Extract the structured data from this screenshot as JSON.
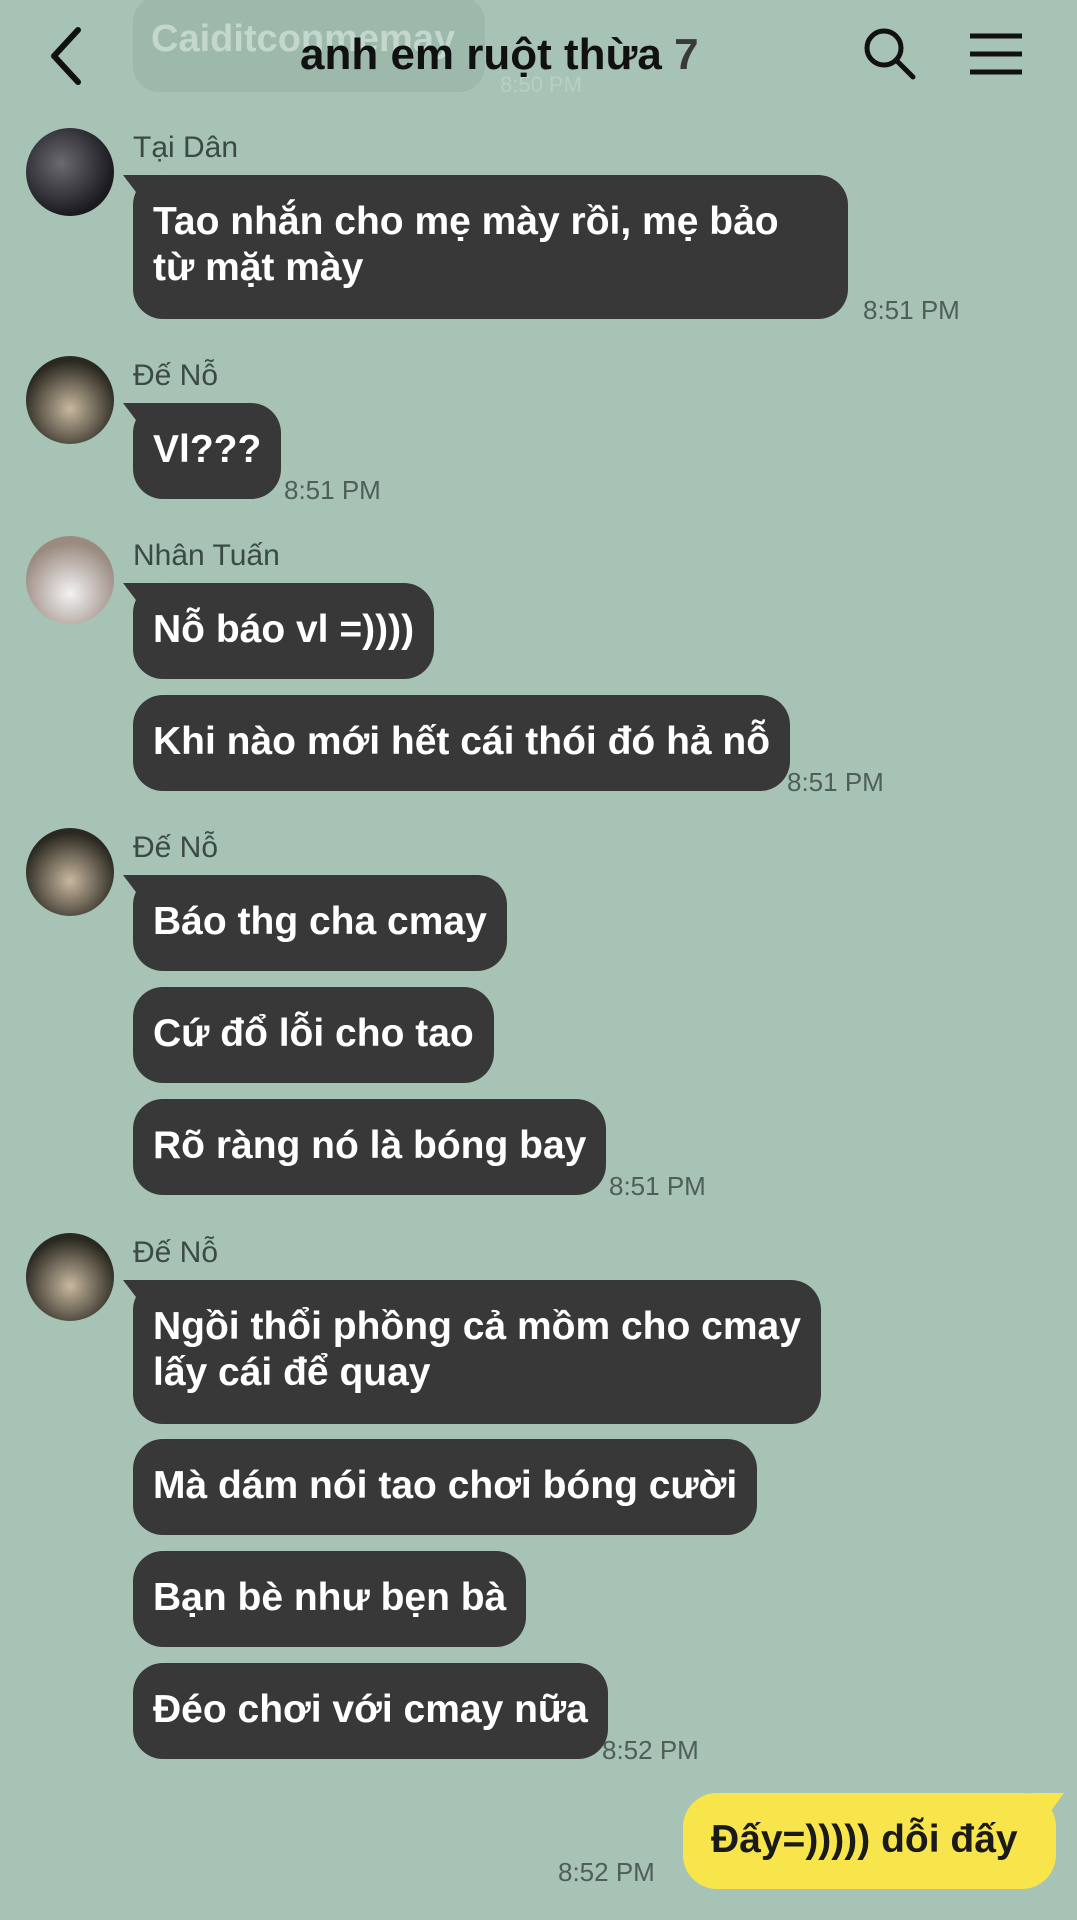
{
  "header": {
    "ghost_message": "Caiditconmemay",
    "ghost_time": "8:50 PM",
    "title": "anh em ruột thừa",
    "member_count": "7"
  },
  "messages": [
    {
      "sender": "Tại Dân",
      "bubbles": [
        "Tao nhắn cho mẹ mày rồi, mẹ bảo từ mặt mày"
      ],
      "time": "8:51 PM"
    },
    {
      "sender": "Đế Nỗ",
      "bubbles": [
        "Vl???"
      ],
      "time": "8:51 PM"
    },
    {
      "sender": "Nhân Tuấn",
      "bubbles": [
        "Nỗ báo vl =))))",
        "Khi nào mới hết cái thói đó hả nỗ"
      ],
      "time": "8:51 PM"
    },
    {
      "sender": "Đế Nỗ",
      "bubbles": [
        "Báo thg cha cmay",
        "Cứ đổ lỗi cho tao",
        "Rõ ràng nó là bóng bay"
      ],
      "time": "8:51 PM"
    },
    {
      "sender": "Đế Nỗ",
      "bubbles": [
        "Ngồi thổi phồng cả mồm cho cmay lấy cái để quay",
        "Mà dám nói tao chơi bóng cười",
        "Bạn bè như bẹn bà",
        "Đéo chơi với cmay nữa"
      ],
      "time": "8:52 PM"
    }
  ],
  "my_message": {
    "text": "Đấy=))))) dỗi đấy",
    "time": "8:52 PM"
  },
  "colors": {
    "background": "#a6c3b5",
    "bubble_other": "#383838",
    "bubble_mine": "#f8e54b"
  },
  "icons": [
    "back-icon",
    "search-icon",
    "menu-icon"
  ]
}
